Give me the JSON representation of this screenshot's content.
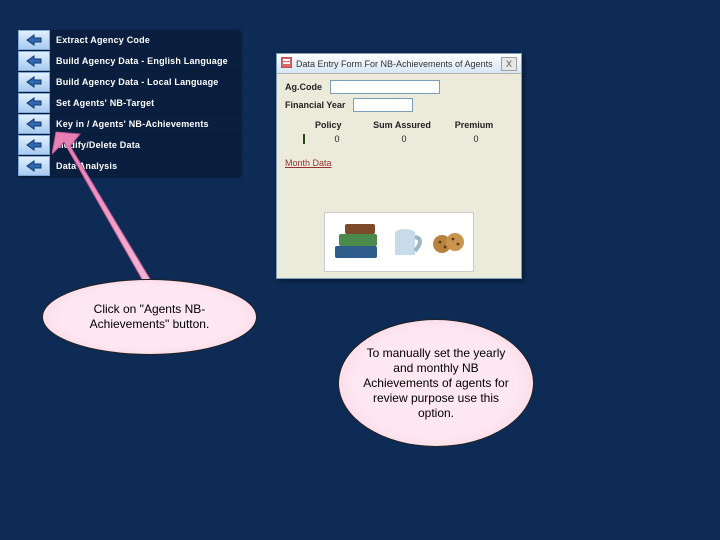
{
  "menu": {
    "items": [
      {
        "label": "Extract Agency Code"
      },
      {
        "label": "Build Agency Data - English Language"
      },
      {
        "label": "Build Agency Data - Local Language"
      },
      {
        "label": "Set Agents' NB-Target"
      },
      {
        "label": "Key in / Agents' NB-Achievements"
      },
      {
        "label": "Modify/Delete Data"
      },
      {
        "label": "Data Analysis"
      }
    ]
  },
  "form": {
    "title": "Data Entry Form For NB-Achievements of Agents",
    "close": "X",
    "agcode_label": "Ag.Code",
    "finyear_label": "Financial Year",
    "columns": {
      "policy": "Policy",
      "sum": "Sum Assured",
      "premium": "Premium"
    },
    "values": {
      "policy": "0",
      "sum": "0",
      "premium": "0"
    },
    "month_link": "Month Data"
  },
  "callouts": {
    "c1": "Click on \"Agents NB-Achievements\" button.",
    "c2": "To  manually set the yearly and monthly NB Achievements of agents for review purpose use this option."
  }
}
